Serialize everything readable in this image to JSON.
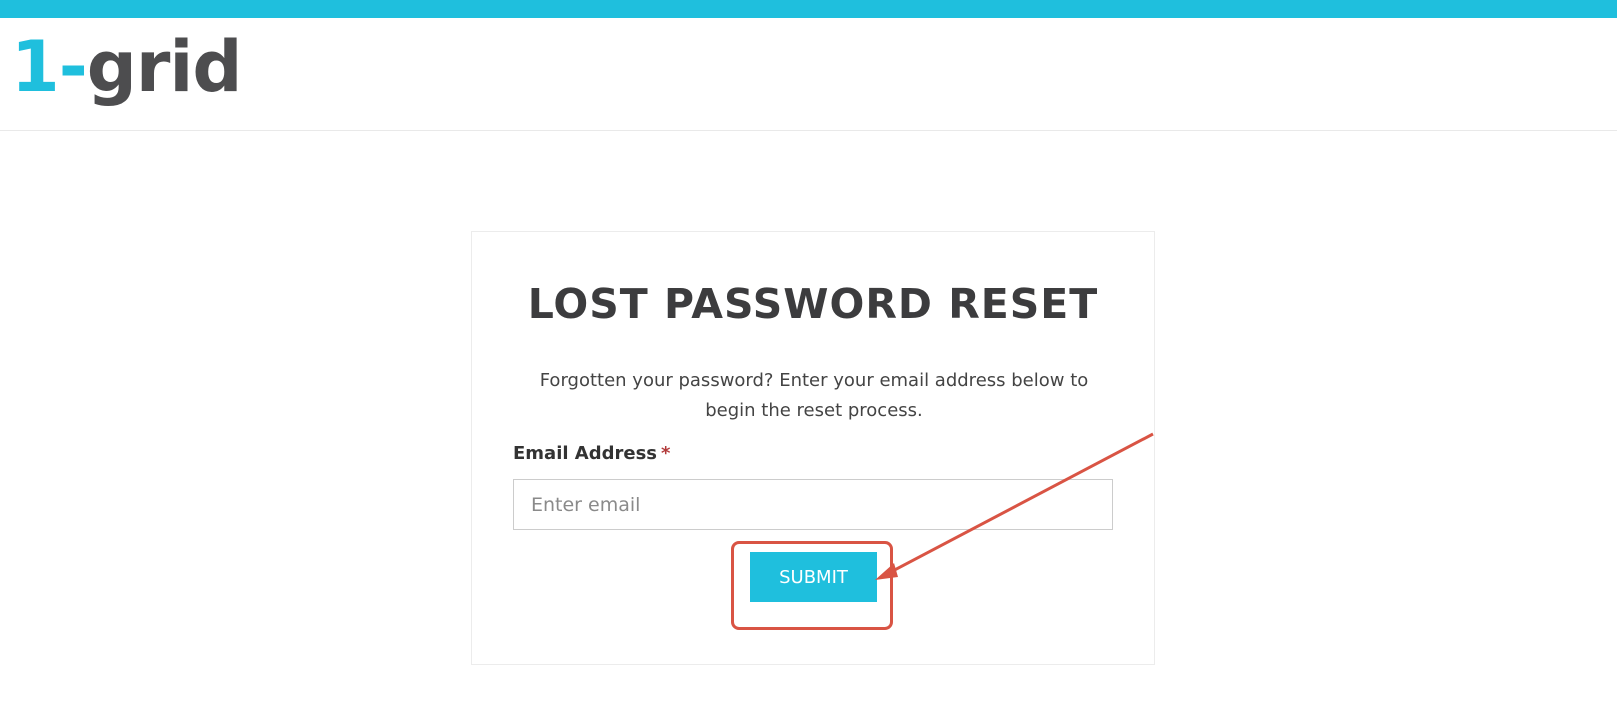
{
  "colors": {
    "accent": "#1fbfdd",
    "logo_dark": "#4d4d4f",
    "annotation": "#d95444"
  },
  "logo": {
    "number": "1-",
    "word": "grid"
  },
  "form": {
    "title": "LOST PASSWORD RESET",
    "description": "Forgotten your password? Enter your email address below to begin the reset process.",
    "email_label": "Email Address",
    "required_mark": "*",
    "email_placeholder": "Enter email",
    "email_value": "",
    "submit_label": "SUBMIT"
  },
  "annotation": {
    "type": "arrow-and-box",
    "target": "submit-button"
  }
}
